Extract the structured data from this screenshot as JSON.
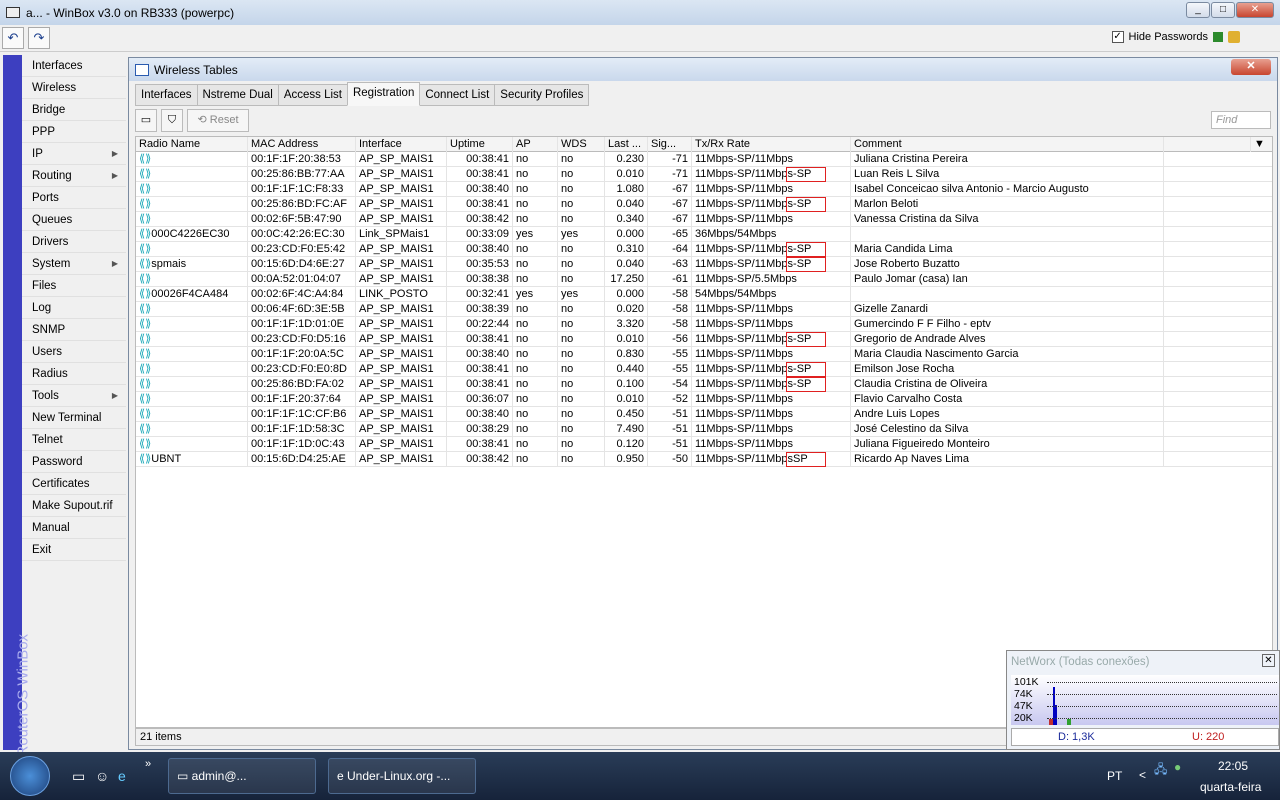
{
  "app": {
    "title": "a... - WinBox v3.0 on RB333 (powerpc)",
    "hide_passwords": "Hide Passwords",
    "brand": "RouterOS WinBox"
  },
  "menu": [
    {
      "label": "Interfaces"
    },
    {
      "label": "Wireless"
    },
    {
      "label": "Bridge"
    },
    {
      "label": "PPP"
    },
    {
      "label": "IP",
      "sub": true
    },
    {
      "label": "Routing",
      "sub": true
    },
    {
      "label": "Ports"
    },
    {
      "label": "Queues"
    },
    {
      "label": "Drivers"
    },
    {
      "label": "System",
      "sub": true
    },
    {
      "label": "Files"
    },
    {
      "label": "Log"
    },
    {
      "label": "SNMP"
    },
    {
      "label": "Users"
    },
    {
      "label": "Radius"
    },
    {
      "label": "Tools",
      "sub": true
    },
    {
      "label": "New Terminal"
    },
    {
      "label": "Telnet"
    },
    {
      "label": "Password"
    },
    {
      "label": "Certificates"
    },
    {
      "label": "Make Supout.rif"
    },
    {
      "label": "Manual"
    },
    {
      "label": "Exit"
    }
  ],
  "window": {
    "title": "Wireless Tables",
    "tabs": [
      "Interfaces",
      "Nstreme Dual",
      "Access List",
      "Registration",
      "Connect List",
      "Security Profiles"
    ],
    "active_tab": "Registration",
    "reset": "Reset",
    "find_placeholder": "Find",
    "status": "21 items"
  },
  "table": {
    "columns": [
      "Radio Name",
      "MAC Address",
      "Interface",
      "Uptime",
      "AP",
      "WDS",
      "Last ...",
      "Sig...",
      "Tx/Rx Rate",
      "Comment"
    ],
    "rows": [
      [
        "",
        "00:1F:1F:20:38:53",
        "AP_SP_MAIS1",
        "00:38:41",
        "no",
        "no",
        "0.230",
        "-71",
        "11Mbps-SP/11Mbps",
        "Juliana Cristina Pereira",
        false
      ],
      [
        "",
        "00:25:86:BB:77:AA",
        "AP_SP_MAIS1",
        "00:38:41",
        "no",
        "no",
        "0.010",
        "-71",
        "11Mbps-SP/11Mbps-SP",
        "Luan Reis L Silva",
        true
      ],
      [
        "",
        "00:1F:1F:1C:F8:33",
        "AP_SP_MAIS1",
        "00:38:40",
        "no",
        "no",
        "1.080",
        "-67",
        "11Mbps-SP/11Mbps",
        "Isabel Conceicao silva Antonio - Marcio Augusto",
        false
      ],
      [
        "",
        "00:25:86:BD:FC:AF",
        "AP_SP_MAIS1",
        "00:38:41",
        "no",
        "no",
        "0.040",
        "-67",
        "11Mbps-SP/11Mbps-SP",
        "Marlon Beloti",
        true
      ],
      [
        "",
        "00:02:6F:5B:47:90",
        "AP_SP_MAIS1",
        "00:38:42",
        "no",
        "no",
        "0.340",
        "-67",
        "11Mbps-SP/11Mbps",
        "Vanessa Cristina da Silva",
        false
      ],
      [
        "000C4226EC30",
        "00:0C:42:26:EC:30",
        "Link_SPMais1",
        "00:33:09",
        "yes",
        "yes",
        "0.000",
        "-65",
        "36Mbps/54Mbps",
        "",
        false
      ],
      [
        "",
        "00:23:CD:F0:E5:42",
        "AP_SP_MAIS1",
        "00:38:40",
        "no",
        "no",
        "0.310",
        "-64",
        "11Mbps-SP/11Mbps-SP",
        "Maria Candida Lima",
        true
      ],
      [
        "spmais",
        "00:15:6D:D4:6E:27",
        "AP_SP_MAIS1",
        "00:35:53",
        "no",
        "no",
        "0.040",
        "-63",
        "11Mbps-SP/11Mbps-SP",
        "Jose Roberto Buzatto",
        true
      ],
      [
        "",
        "00:0A:52:01:04:07",
        "AP_SP_MAIS1",
        "00:38:38",
        "no",
        "no",
        "17.250",
        "-61",
        "11Mbps-SP/5.5Mbps",
        "Paulo Jomar (casa) Ian",
        false
      ],
      [
        "00026F4CA484",
        "00:02:6F:4C:A4:84",
        "LINK_POSTO",
        "00:32:41",
        "yes",
        "yes",
        "0.000",
        "-58",
        "54Mbps/54Mbps",
        "",
        false
      ],
      [
        "",
        "00:06:4F:6D:3E:5B",
        "AP_SP_MAIS1",
        "00:38:39",
        "no",
        "no",
        "0.020",
        "-58",
        "11Mbps-SP/11Mbps",
        "Gizelle Zanardi",
        false
      ],
      [
        "",
        "00:1F:1F:1D:01:0E",
        "AP_SP_MAIS1",
        "00:22:44",
        "no",
        "no",
        "3.320",
        "-58",
        "11Mbps-SP/11Mbps",
        "Gumercindo F F Filho - eptv",
        false
      ],
      [
        "",
        "00:23:CD:F0:D5:16",
        "AP_SP_MAIS1",
        "00:38:41",
        "no",
        "no",
        "0.010",
        "-56",
        "11Mbps-SP/11Mbps-SP",
        "Gregorio de Andrade Alves",
        true
      ],
      [
        "",
        "00:1F:1F:20:0A:5C",
        "AP_SP_MAIS1",
        "00:38:40",
        "no",
        "no",
        "0.830",
        "-55",
        "11Mbps-SP/11Mbps",
        "Maria Claudia Nascimento Garcia",
        false
      ],
      [
        "",
        "00:23:CD:F0:E0:8D",
        "AP_SP_MAIS1",
        "00:38:41",
        "no",
        "no",
        "0.440",
        "-55",
        "11Mbps-SP/11Mbps-SP",
        "Emilson Jose Rocha",
        true
      ],
      [
        "",
        "00:25:86:BD:FA:02",
        "AP_SP_MAIS1",
        "00:38:41",
        "no",
        "no",
        "0.100",
        "-54",
        "11Mbps-SP/11Mbps-SP",
        "Claudia Cristina de Oliveira",
        true
      ],
      [
        "",
        "00:1F:1F:20:37:64",
        "AP_SP_MAIS1",
        "00:36:07",
        "no",
        "no",
        "0.010",
        "-52",
        "11Mbps-SP/11Mbps",
        "Flavio Carvalho Costa",
        false
      ],
      [
        "",
        "00:1F:1F:1C:CF:B6",
        "AP_SP_MAIS1",
        "00:38:40",
        "no",
        "no",
        "0.450",
        "-51",
        "11Mbps-SP/11Mbps",
        "Andre Luis Lopes",
        false
      ],
      [
        "",
        "00:1F:1F:1D:58:3C",
        "AP_SP_MAIS1",
        "00:38:29",
        "no",
        "no",
        "7.490",
        "-51",
        "11Mbps-SP/11Mbps",
        "José Celestino da Silva",
        false
      ],
      [
        "",
        "00:1F:1F:1D:0C:43",
        "AP_SP_MAIS1",
        "00:38:41",
        "no",
        "no",
        "0.120",
        "-51",
        "11Mbps-SP/11Mbps",
        "Juliana Figueiredo Monteiro",
        false
      ],
      [
        "UBNT",
        "00:15:6D:D4:25:AE",
        "AP_SP_MAIS1",
        "00:38:42",
        "no",
        "no",
        "0.950",
        "-50",
        "11Mbps-SP/11MbpsSP",
        "Ricardo Ap Naves Lima",
        true
      ]
    ]
  },
  "networx": {
    "title": "NetWorx (Todas conexões)",
    "y_labels": [
      "101K",
      "74K",
      "47K",
      "20K"
    ],
    "download": "D: 1,3K",
    "upload": "U: 220"
  },
  "taskbar": {
    "tasks": [
      "admin@...",
      "Under-Linux.org -..."
    ],
    "lang": "PT",
    "time": "22:05",
    "day": "quarta-feira"
  },
  "colors": {
    "brand": "#3d3fc0",
    "highlight": "#e02020"
  }
}
